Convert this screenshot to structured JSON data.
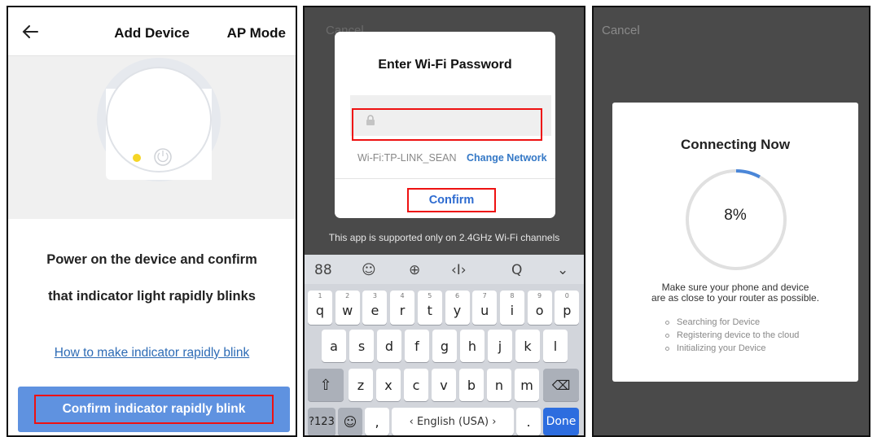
{
  "panel1": {
    "title": "Add Device",
    "ap_mode": "AP Mode",
    "instruction_line1": "Power on the device and confirm",
    "instruction_line2": "that indicator light rapidly blinks",
    "howto_link": "How to make indicator rapidly blink",
    "confirm_button": "Confirm indicator rapidly blink",
    "icons": {
      "back": "arrow-left-icon",
      "power": "power-icon"
    }
  },
  "panel2": {
    "cancel": "Cancel",
    "dialog_title": "Enter Wi-Fi Password",
    "wifi_name": "Wi-Fi:TP-LINK_SEAN",
    "change_network": "Change Network",
    "confirm": "Confirm",
    "support_note": "This app is supported only on 2.4GHz Wi-Fi channels",
    "keyboard": {
      "toolbar": [
        "88",
        "☺",
        "⊕",
        "‹I›",
        "Q",
        "⌄"
      ],
      "row1": [
        {
          "ch": "q",
          "num": "1"
        },
        {
          "ch": "w",
          "num": "2"
        },
        {
          "ch": "e",
          "num": "3"
        },
        {
          "ch": "r",
          "num": "4"
        },
        {
          "ch": "t",
          "num": "5"
        },
        {
          "ch": "y",
          "num": "6"
        },
        {
          "ch": "u",
          "num": "7"
        },
        {
          "ch": "i",
          "num": "8"
        },
        {
          "ch": "o",
          "num": "9"
        },
        {
          "ch": "p",
          "num": "0"
        }
      ],
      "row2": [
        "a",
        "s",
        "d",
        "f",
        "g",
        "h",
        "j",
        "k",
        "l"
      ],
      "row3": [
        "z",
        "x",
        "c",
        "v",
        "b",
        "n",
        "m"
      ],
      "shift": "⇧",
      "backspace": "⌫",
      "symbols": "?123",
      "emoji": "☺",
      "comma": ",",
      "space": "‹ English (USA) ›",
      "period": ".",
      "done": "Done"
    }
  },
  "panel3": {
    "cancel": "Cancel",
    "title": "Connecting Now",
    "progress": 8,
    "progress_label": "8%",
    "message_line1": "Make sure your phone and device",
    "message_line2": "are as close to your router as possible.",
    "steps": [
      "Searching for Device",
      "Registering device to the cloud",
      "Initializing your Device"
    ]
  },
  "colors": {
    "accent_blue": "#5f92e0",
    "link_blue": "#2d6bb5",
    "highlight_red": "#e11111",
    "overlay_gray": "#4a4a4a",
    "ring_progress": "#4a86d8",
    "ring_track": "#e0e0e0"
  }
}
